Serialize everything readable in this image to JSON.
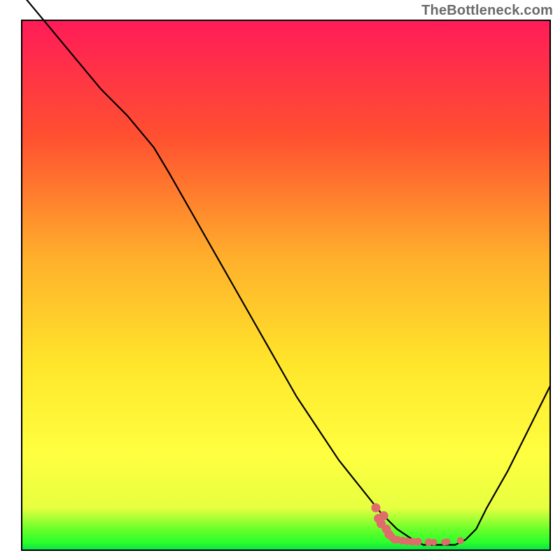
{
  "attribution": "TheBottleneck.com",
  "chart_data": {
    "type": "line",
    "title": "",
    "xlabel": "",
    "ylabel": "",
    "xlim": [
      0,
      100
    ],
    "ylim": [
      0,
      100
    ],
    "grid": false,
    "series": [
      {
        "name": "bottleneck-curve",
        "x": [
          0,
          5,
          10,
          15,
          20,
          25,
          28,
          32,
          36,
          40,
          44,
          48,
          52,
          56,
          60,
          64,
          68,
          71,
          74,
          76,
          78,
          80,
          82,
          84,
          86,
          88,
          92,
          96,
          100
        ],
        "y": [
          105,
          99,
          93,
          87,
          82,
          76,
          71,
          64,
          57,
          50,
          43,
          36,
          29,
          23,
          17,
          12,
          7,
          4,
          2,
          1,
          1,
          1,
          1,
          2,
          4,
          8,
          15,
          23,
          31
        ]
      }
    ],
    "markers": {
      "name": "highlight-region",
      "color": "#e06b6b",
      "points": [
        {
          "x": 67.0,
          "y": 8.0
        },
        {
          "x": 67.5,
          "y": 6.0
        },
        {
          "x": 68.0,
          "y": 5.0
        },
        {
          "x": 68.5,
          "y": 6.5
        },
        {
          "x": 69.0,
          "y": 4.0
        },
        {
          "x": 69.5,
          "y": 3.0
        },
        {
          "x": 70.0,
          "y": 2.5
        },
        {
          "x": 70.5,
          "y": 2.0
        },
        {
          "x": 71.0,
          "y": 2.0
        },
        {
          "x": 72.0,
          "y": 1.8
        },
        {
          "x": 73.0,
          "y": 1.7
        },
        {
          "x": 74.0,
          "y": 1.6
        },
        {
          "x": 75.0,
          "y": 1.6
        },
        {
          "x": 77.0,
          "y": 1.5
        },
        {
          "x": 78.0,
          "y": 1.5
        },
        {
          "x": 80.0,
          "y": 1.5
        },
        {
          "x": 80.5,
          "y": 1.6
        },
        {
          "x": 83.0,
          "y": 1.8
        }
      ]
    },
    "bands": [
      {
        "name": "green-band",
        "y0": 0.0,
        "y1": 2.0,
        "color_top": "#2bff2b",
        "color_bot": "#0be04a"
      },
      {
        "name": "lime-band",
        "y0": 2.0,
        "y1": 18.0,
        "color_top": "#ffff60",
        "color_bot": "#6bff2b"
      },
      {
        "name": "yellow-band",
        "y0": 18.0,
        "y1": 50.0,
        "color_top": "#ffcb2b",
        "color_bot": "#ffff40"
      },
      {
        "name": "orange-band",
        "y0": 50.0,
        "y1": 78.0,
        "color_top": "#ff6b2b",
        "color_bot": "#ffb02b"
      },
      {
        "name": "red-band",
        "y0": 78.0,
        "y1": 100.0,
        "color_top": "#ff1b58",
        "color_bot": "#ff5030"
      }
    ]
  }
}
